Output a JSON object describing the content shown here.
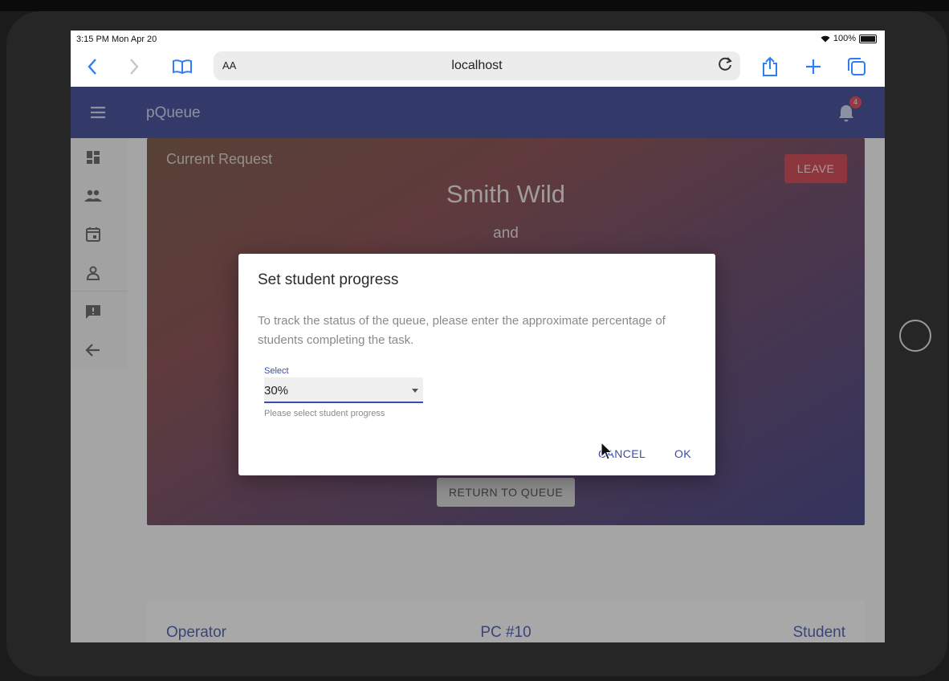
{
  "status_bar": {
    "time": "3:15 PM   Mon Apr 20",
    "battery": "100%"
  },
  "browser": {
    "text_size_label": "AA",
    "url": "localhost"
  },
  "app": {
    "title": "pQueue",
    "notification_count": "4"
  },
  "sidebar": {
    "items": [
      "dashboard-icon",
      "people-icon",
      "calendar-icon",
      "person-icon",
      "feedback-icon",
      "back-arrow-icon"
    ]
  },
  "current_request": {
    "heading": "Current Request",
    "name": "Smith Wild",
    "connector": "and",
    "leave_label": "LEAVE",
    "return_label": "RETURN TO QUEUE"
  },
  "info_row": {
    "operator": "Operator",
    "pc": "PC #10",
    "student": "Student"
  },
  "dialog": {
    "title": "Set student progress",
    "text": "To track the status of the queue, please enter the approximate percentage of students completing the task.",
    "select_label": "Select",
    "select_value": "30%",
    "helper": "Please select student progress",
    "cancel_label": "CANCEL",
    "ok_label": "OK"
  },
  "colors": {
    "app_bar": "#2e3a8a",
    "accent": "#3b4bb0",
    "leave": "#c8323f"
  }
}
